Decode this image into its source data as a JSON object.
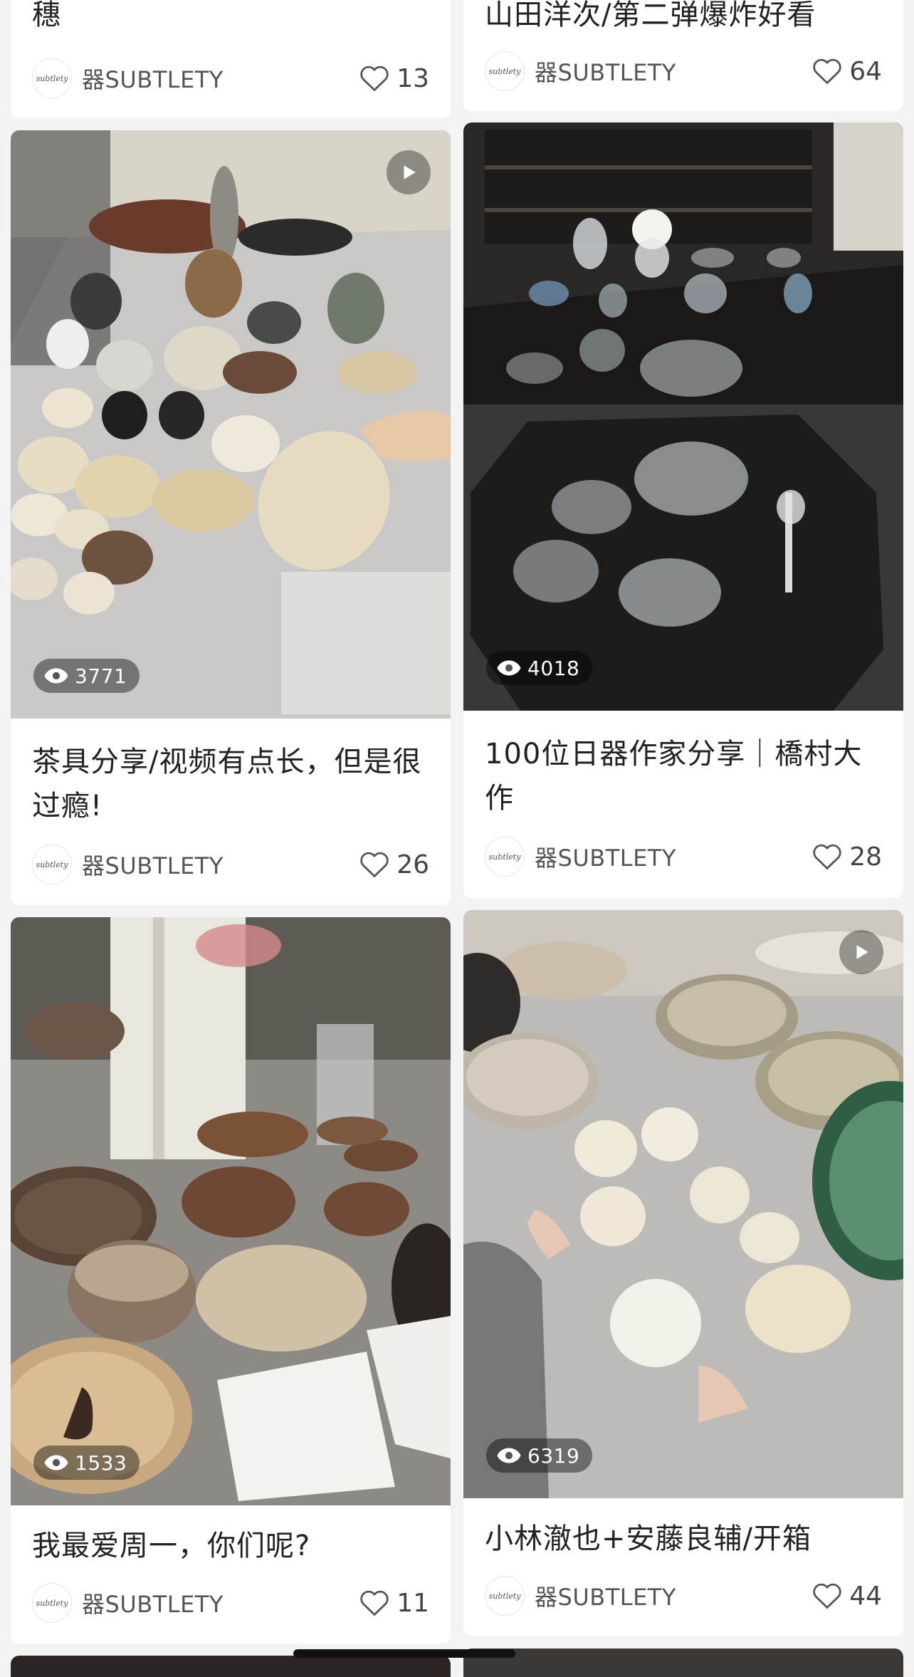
{
  "feed": {
    "cards": [
      {
        "title": "穗",
        "author": "器SUBTLETY",
        "avatar_text": "subtlety",
        "likes": "13"
      },
      {
        "title": "山田洋次/第二弹爆炸好看",
        "author": "器SUBTLETY",
        "avatar_text": "subtlety",
        "likes": "64"
      },
      {
        "title": "茶具分享/视频有点长，但是很过瘾!",
        "author": "器SUBTLETY",
        "avatar_text": "subtlety",
        "likes": "26",
        "views": "3771",
        "is_video": true
      },
      {
        "title": "100位日器作家分享｜橋村大作",
        "author": "器SUBTLETY",
        "avatar_text": "subtlety",
        "likes": "28",
        "views": "4018"
      },
      {
        "title": "我最爱周一，你们呢?",
        "author": "器SUBTLETY",
        "avatar_text": "subtlety",
        "likes": "11",
        "views": "1533"
      },
      {
        "title": "小林澈也+安藤良辅/开箱",
        "author": "器SUBTLETY",
        "avatar_text": "subtlety",
        "likes": "44",
        "views": "6319",
        "is_video": true
      }
    ]
  },
  "icons": {
    "eye": "eye-icon",
    "heart": "heart-outline-icon",
    "play": "play-icon"
  },
  "colors": {
    "background": "#f3f3f3",
    "card": "#ffffff",
    "text": "#222222",
    "meta": "#555555"
  }
}
